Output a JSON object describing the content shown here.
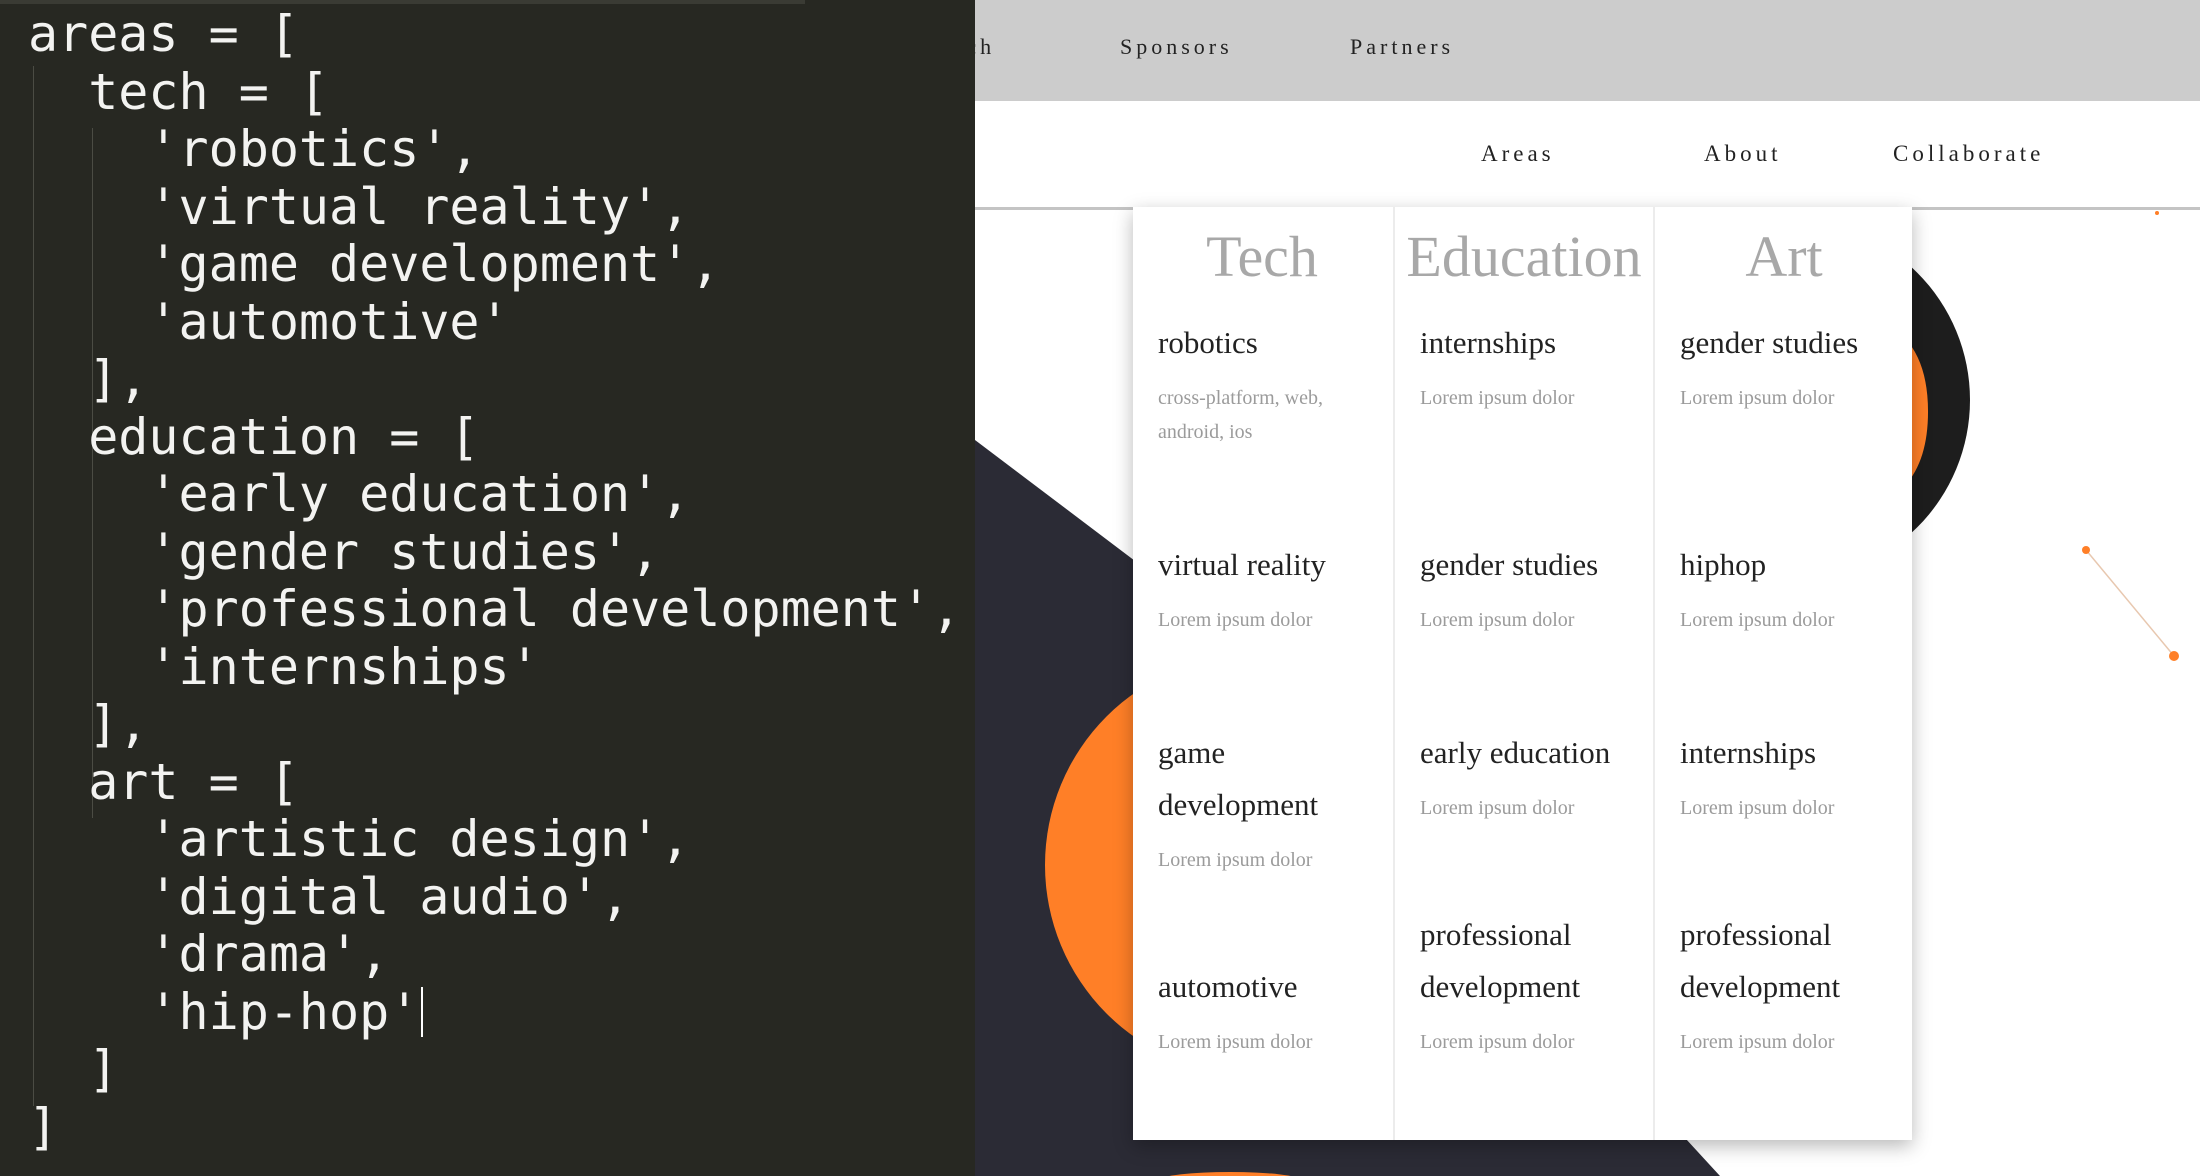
{
  "colors": {
    "accent": "#ff7f27",
    "dark": "#2b2b35",
    "topbar": "#cccccc",
    "editor_bg": "#272822"
  },
  "site": {
    "topnav": {
      "search_partial": "rch",
      "sponsors": "Sponsors",
      "partners": "Partners"
    },
    "mainnav": {
      "areas": "Areas",
      "about": "About",
      "collaborate": "Collaborate"
    },
    "hero": {
      "big_letter": "O"
    }
  },
  "dropdown": {
    "columns": [
      {
        "heading": "Tech",
        "items": [
          {
            "title": "robotics",
            "desc": "cross-platform, web, android, ios"
          },
          {
            "title": "virtual reality",
            "desc": "Lorem ipsum dolor"
          },
          {
            "title": "game development",
            "desc": "Lorem ipsum dolor"
          },
          {
            "title": "automotive",
            "desc": "Lorem ipsum dolor"
          }
        ]
      },
      {
        "heading": "Education",
        "items": [
          {
            "title": "internships",
            "desc": "Lorem ipsum dolor"
          },
          {
            "title": "gender studies",
            "desc": "Lorem ipsum dolor"
          },
          {
            "title": "early education",
            "desc": "Lorem ipsum dolor"
          },
          {
            "title": "professional development",
            "desc": "Lorem ipsum dolor"
          }
        ]
      },
      {
        "heading": "Art",
        "items": [
          {
            "title": "gender studies",
            "desc": "Lorem ipsum dolor"
          },
          {
            "title": "hiphop",
            "desc": "Lorem ipsum dolor"
          },
          {
            "title": "internships",
            "desc": "Lorem ipsum dolor"
          },
          {
            "title": "professional development",
            "desc": "Lorem ipsum dolor"
          }
        ]
      }
    ]
  },
  "code": {
    "lines": [
      "areas = [",
      "  tech = [",
      "    'robotics',",
      "    'virtual reality',",
      "    'game development',",
      "    'automotive'",
      "  ],",
      "  education = [",
      "    'early education',",
      "    'gender studies',",
      "    'professional development',",
      "    'internships'",
      "  ],",
      "  art = [",
      "    'artistic design',",
      "    'digital audio',",
      "    'drama',",
      "    'hip-hop'",
      "  ]",
      "]"
    ]
  }
}
